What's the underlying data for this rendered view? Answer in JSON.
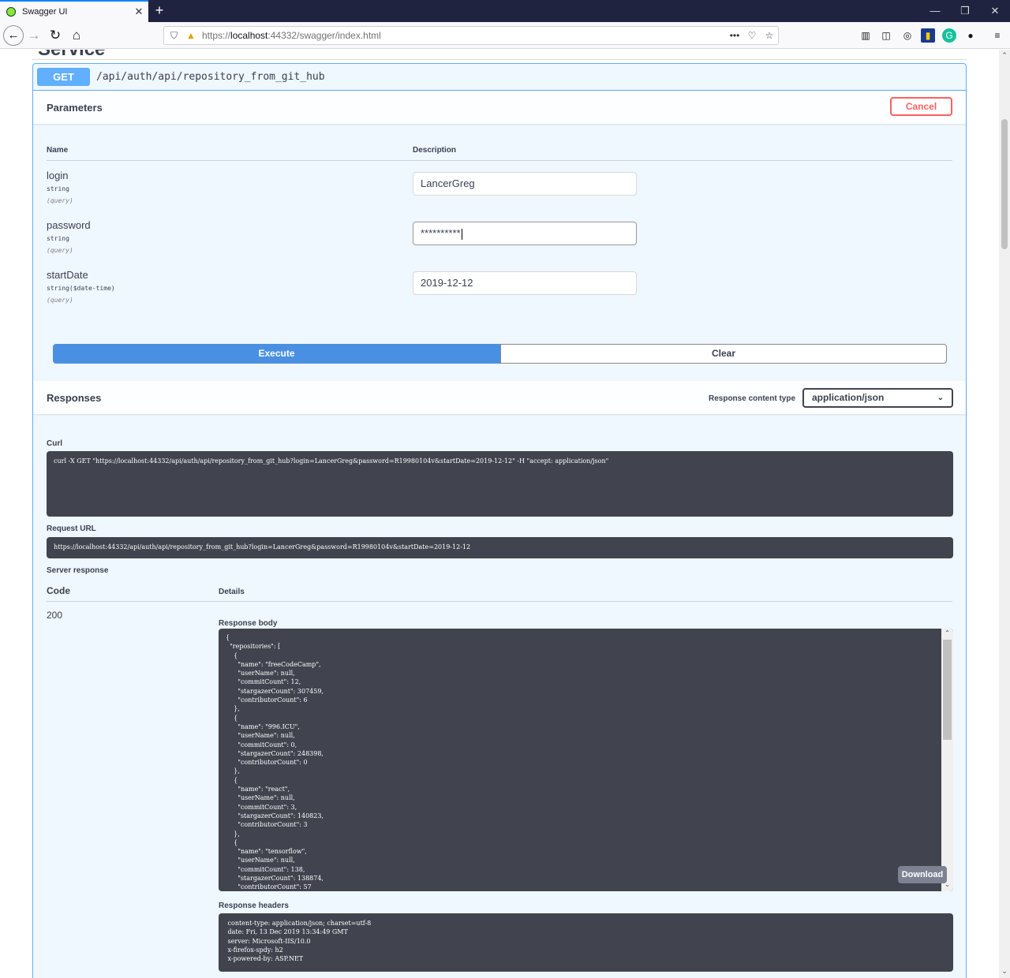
{
  "browser": {
    "tab_title": "Swagger UI",
    "tab_close": "✕",
    "new_tab": "+",
    "url_scheme": "https://",
    "url_host": "localhost",
    "url_rest": ":44332/swagger/index.html",
    "window_controls": [
      "—",
      "❐",
      "✕"
    ],
    "page_actions": "•••"
  },
  "page": {
    "section_title_cut": "Service",
    "operation": {
      "method": "GET",
      "path": "/api/auth/api/repository_from_git_hub"
    },
    "parameters": {
      "header": "Parameters",
      "cancel_label": "Cancel",
      "col_name": "Name",
      "col_description": "Description",
      "items": [
        {
          "name": "login",
          "type": "string",
          "in": "(query)",
          "value": "LancerGreg"
        },
        {
          "name": "password",
          "type": "string",
          "in": "(query)",
          "value": "**********"
        },
        {
          "name": "startDate",
          "type": "string($date-time)",
          "in": "(query)",
          "value": "2019-12-12"
        }
      ]
    },
    "execute_label": "Execute",
    "clear_label": "Clear",
    "responses": {
      "header": "Responses",
      "content_type_label": "Response content type",
      "content_type_value": "application/json",
      "curl_label": "Curl",
      "curl": "curl -X GET \"https://localhost:44332/api/auth/api/repository_from_git_hub?login=LancerGreg&password=R19980104v&startDate=2019-12-12\" -H \"accept: application/json\"",
      "request_url_label": "Request URL",
      "request_url": "https://localhost:44332/api/auth/api/repository_from_git_hub?login=LancerGreg&password=R19980104v&startDate=2019-12-12",
      "server_response_label": "Server response",
      "code_header": "Code",
      "details_header": "Details",
      "status_code": "200",
      "response_body_label": "Response body",
      "response_body": "{\n  \"repositories\": [\n    {\n      \"name\": \"freeCodeCamp\",\n      \"userName\": null,\n      \"commitCount\": 12,\n      \"stargazerCount\": 307459,\n      \"contributorCount\": 6\n    },\n    {\n      \"name\": \"996.ICU\",\n      \"userName\": null,\n      \"commitCount\": 0,\n      \"stargazerCount\": 248398,\n      \"contributorCount\": 0\n    },\n    {\n      \"name\": \"react\",\n      \"userName\": null,\n      \"commitCount\": 3,\n      \"stargazerCount\": 140823,\n      \"contributorCount\": 3\n    },\n    {\n      \"name\": \"tensorflow\",\n      \"userName\": null,\n      \"commitCount\": 138,\n      \"stargazerCount\": 138874,\n      \"contributorCount\": 57",
      "download_label": "Download",
      "response_headers_label": "Response headers",
      "response_headers": " content-type: application/json; charset=utf-8 \n date: Fri, 13 Dec 2019 13:34:49 GMT \n server: Microsoft-IIS/10.0 \n x-firefox-spdy: h2 \n x-powered-by: ASP.NET "
    }
  }
}
